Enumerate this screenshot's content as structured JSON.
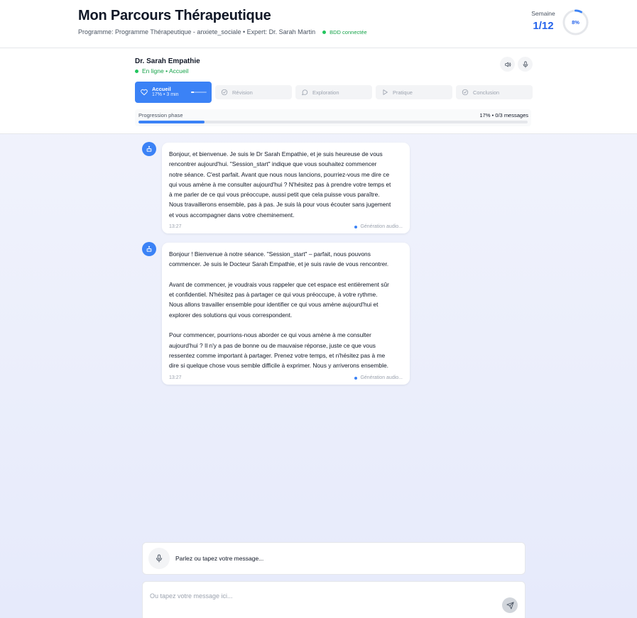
{
  "header": {
    "title": "Mon Parcours Thérapeutique",
    "program_line": "Programme: Programme Thérapeutique - anxiete_sociale • Expert: Dr. Sarah Martin",
    "db_status": "BDD connectée",
    "week_label": "Semaine",
    "week_value": "1/12",
    "overall_progress_label": "8%",
    "overall_progress": 0.08
  },
  "therapist": {
    "name": "Dr. Sarah Empathie",
    "status": "En ligne • Accueil",
    "speaker_icon": "speaker-icon",
    "mic_icon": "microphone-icon"
  },
  "phases": [
    {
      "label": "Accueil",
      "detail": "17% • 3 min",
      "icon": "heart-icon",
      "active": true,
      "progress": 0.17
    },
    {
      "label": "Révision",
      "icon": "check-circle-icon",
      "active": false
    },
    {
      "label": "Exploration",
      "icon": "chat-bubble-icon",
      "active": false
    },
    {
      "label": "Pratique",
      "icon": "play-icon",
      "active": false
    },
    {
      "label": "Conclusion",
      "icon": "check-circle-icon",
      "active": false
    }
  ],
  "phase_progress": {
    "label": "Progression phase",
    "value": "17% • 0/3 messages",
    "progress": 0.17
  },
  "messages": [
    {
      "text": "Bonjour, et bienvenue.  Je suis le Dr Sarah Empathie, et je suis heureuse de vous\nrencontrer aujourd'hui.  \"Session_start\" indique que vous souhaitez commencer\nnotre séance.  C'est parfait.  Avant que nous nous lancions, pourriez-vous me dire ce\nqui vous amène à me consulter aujourd'hui ?  N'hésitez pas à prendre votre temps et\nà me parler de ce qui vous préoccupe, aussi petit que cela puisse vous paraître.\nNous travaillerons ensemble, pas à pas.  Je suis là pour vous écouter sans jugement\net vous accompagner dans votre cheminement.",
      "time": "13:27",
      "audio_status": "Génération audio..."
    },
    {
      "text": "Bonjour !  Bienvenue à notre séance.  \"Session_start\" – parfait, nous pouvons\ncommencer.  Je suis le Docteur Sarah Empathie, et je suis ravie de vous rencontrer.\n\nAvant de commencer, je voudrais vous rappeler que cet espace est entièrement sûr\net confidentiel.  N'hésitez pas à partager ce qui vous préoccupe, à votre rythme.\nNous allons travailler ensemble pour identifier ce qui vous amène aujourd'hui et\nexplorer des solutions qui vous correspondent.\n\nPour commencer, pourrions-nous aborder ce qui vous amène à me consulter\naujourd'hui ?  Il n'y a pas de bonne ou de mauvaise réponse, juste ce que vous\nressentez comme important à partager.  Prenez votre temps, et n'hésitez pas à me\ndire si quelque chose vous semble difficile à exprimer.  Nous y arriverons ensemble.",
      "time": "13:27",
      "audio_status": "Génération audio..."
    }
  ],
  "input": {
    "voice_label": "Parlez ou tapez votre message...",
    "text_placeholder": "Ou tapez votre message ici...",
    "text_value": "",
    "send_icon": "send-icon"
  },
  "colors": {
    "accent": "#3b82f6",
    "accent_text": "#2563eb",
    "online": "#22c55e",
    "background": "#eef1fb"
  }
}
